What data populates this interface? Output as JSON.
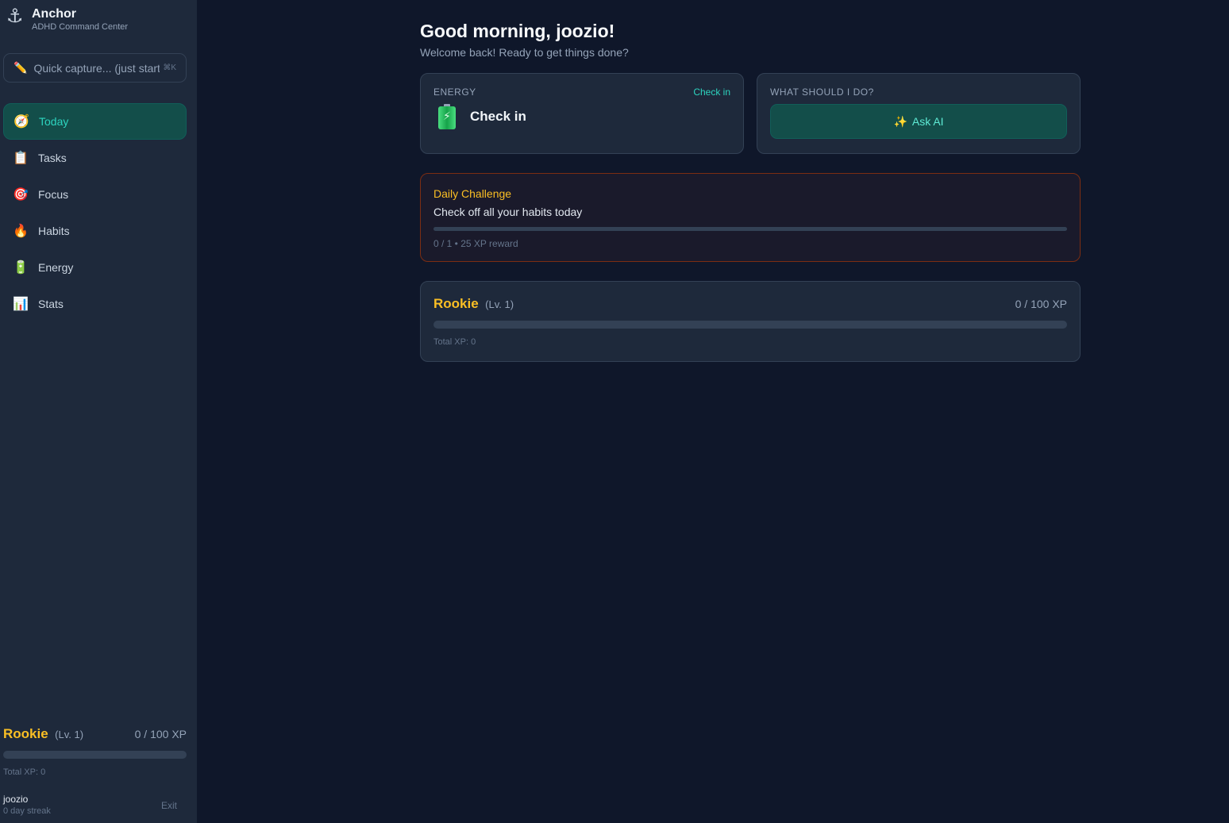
{
  "app": {
    "title": "Anchor",
    "subtitle": "ADHD Command Center",
    "logo_icon": "anchor-icon"
  },
  "capture": {
    "placeholder": "Quick capture... (just start typing)",
    "shortcut": "⌘K",
    "icon": "pencil-icon"
  },
  "nav": [
    {
      "label": "Today",
      "icon": "compass-icon",
      "active": true
    },
    {
      "label": "Tasks",
      "icon": "clipboard-icon",
      "active": false
    },
    {
      "label": "Focus",
      "icon": "target-icon",
      "active": false
    },
    {
      "label": "Habits",
      "icon": "fire-icon",
      "active": false
    },
    {
      "label": "Energy",
      "icon": "battery-icon",
      "active": false
    },
    {
      "label": "Stats",
      "icon": "bar-chart-icon",
      "active": false
    }
  ],
  "sidebar_level": {
    "rank": "Rookie",
    "level": "(Lv. 1)",
    "xp": "0 / 100 XP",
    "progress": 0,
    "total": "Total XP: 0"
  },
  "user": {
    "name": "joozio",
    "streak": "0 day streak",
    "exit_label": "Exit"
  },
  "main": {
    "greeting": "Good morning, joozio!",
    "welcome": "Welcome back! Ready to get things done?",
    "energy": {
      "label": "ENERGY",
      "link": "Check in",
      "value": "Check in"
    },
    "ai": {
      "label": "WHAT SHOULD I DO?",
      "button": "Ask AI"
    },
    "challenge": {
      "title": "Daily Challenge",
      "desc": "Check off all your habits today",
      "progress": 0,
      "meta": "0 / 1 • 25 XP reward"
    },
    "level": {
      "rank": "Rookie",
      "level": "(Lv. 1)",
      "xp": "0 / 100 XP",
      "progress": 0,
      "total": "Total XP: 0"
    }
  },
  "colors": {
    "accent": "#2dd4bf",
    "rank": "#fbbf24",
    "background": "#0f172a",
    "sidebar": "#1e293b"
  }
}
